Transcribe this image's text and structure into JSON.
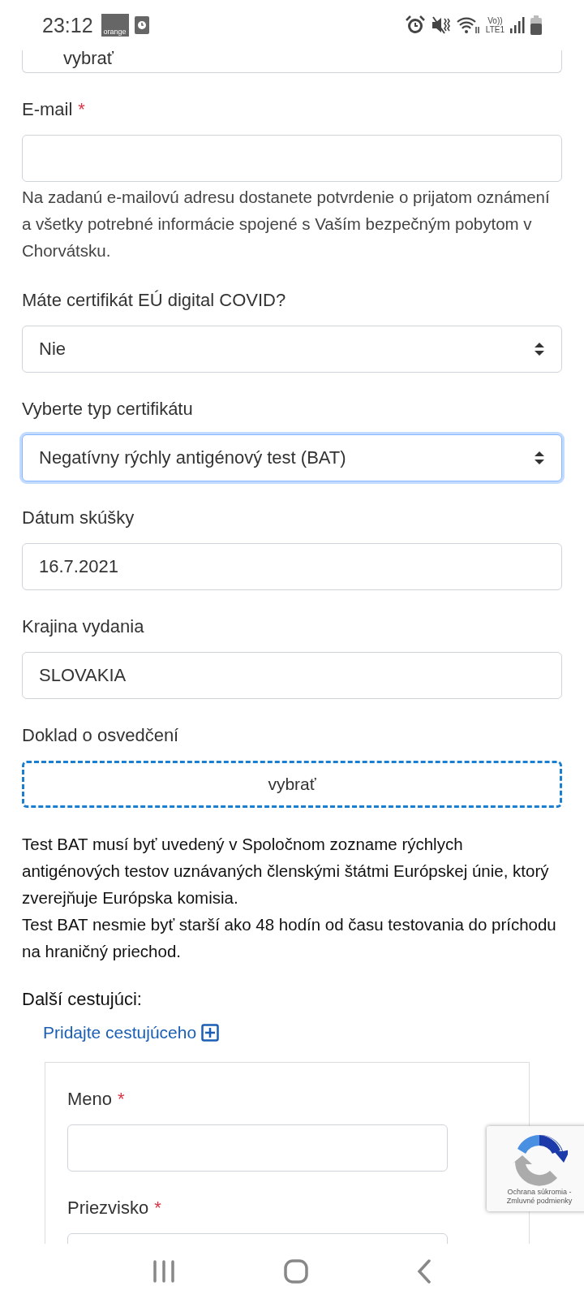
{
  "status_bar": {
    "time": "23:12",
    "carrier": "orange",
    "volte": "Vo))",
    "network": "LTE1"
  },
  "top_field": {
    "label": "vybrať"
  },
  "fields": [
    {
      "kind": "input",
      "label": "E-mail",
      "required_mark": "*",
      "help": "Na zadanú e-mailovú adresu dostanete potvrdenie o prijatom oznámení a všetky potrebné informácie spojené s Vaším bezpečným pobytom v Chorvátsku."
    },
    {
      "kind": "select",
      "label": "Máte certifikát EÚ digital COVID?",
      "value": "Nie",
      "focused": false
    },
    {
      "kind": "select",
      "label": "Vyberte typ certifikátu",
      "value": "Negatívny rýchly antigénový test (BAT)",
      "focused": true
    },
    {
      "kind": "input",
      "label": "Dátum skúšky",
      "value": "16.7.2021"
    },
    {
      "kind": "input",
      "label": "Krajina vydania",
      "value": "SLOVAKIA"
    },
    {
      "kind": "file",
      "label": "Doklad o osvedčení",
      "value": "vybrať"
    }
  ],
  "notice": [
    "Test BAT musí byť uvedený v Spoločnom zozname rýchlych antigénových testov uznávaných členskými štátmi Európskej únie, ktorý zverejňuje Európska komisia.",
    "Test BAT nesmie byť starší ako 48 hodín od času testovania do príchodu na hraničný priechod."
  ],
  "travellers": {
    "heading": "Další cestujúci:",
    "add_link": "Pridajte cestujúceho",
    "card_fields": [
      {
        "label": "Meno",
        "required_mark": "*"
      },
      {
        "label": "Priezvisko",
        "required_mark": "*"
      }
    ]
  },
  "recaptcha": {
    "privacy": "Ochrana súkromia",
    "separator": "-",
    "terms": "Zmluvné podmienky"
  }
}
